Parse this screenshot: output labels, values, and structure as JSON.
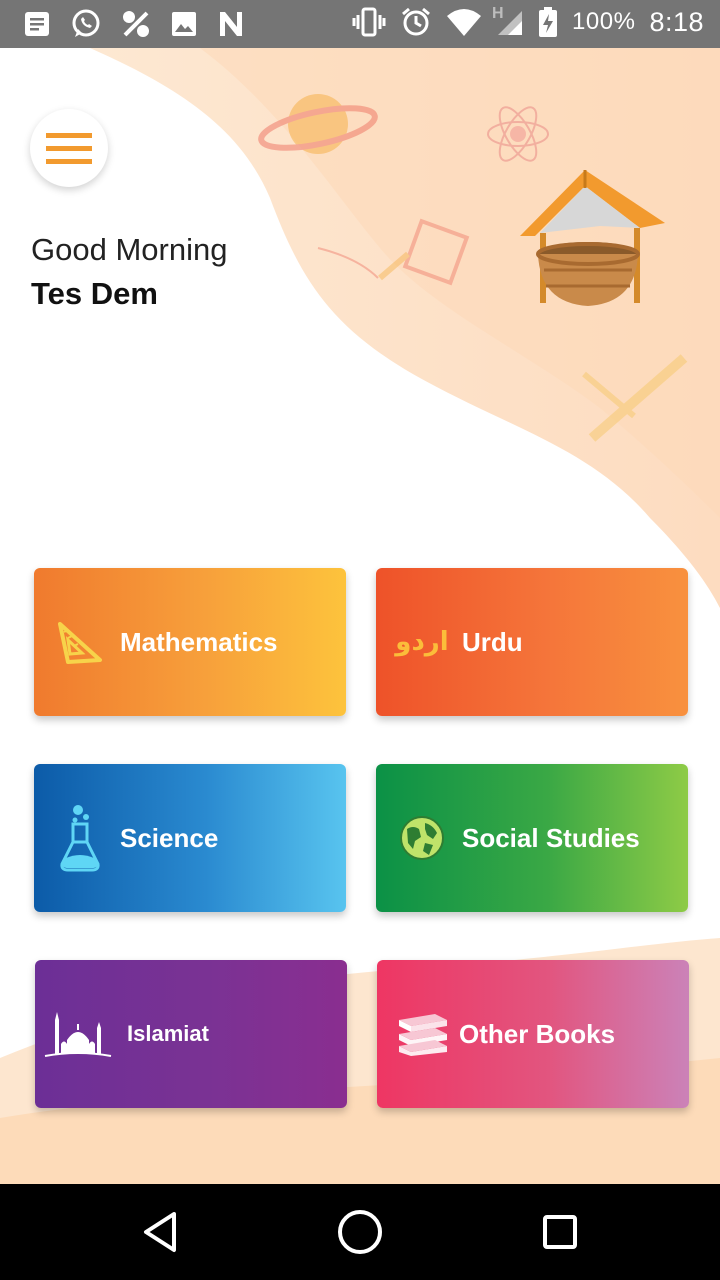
{
  "status_bar": {
    "battery_percent": "100%",
    "time": "8:18",
    "network_type": "H",
    "icons_left": [
      "notes-icon",
      "whatsapp-icon",
      "percent-icon",
      "image-icon",
      "n-icon"
    ],
    "icons_right": [
      "vibrate-icon",
      "alarm-icon",
      "wifi-icon",
      "signal-icon",
      "battery-charging-icon"
    ]
  },
  "header": {
    "greeting": "Good Morning",
    "user_name": "Tes Dem"
  },
  "subjects": [
    {
      "label": "Mathematics",
      "icon": "set-square-icon"
    },
    {
      "label": "Urdu",
      "icon": "urdu-script-icon",
      "icon_text": "اردو"
    },
    {
      "label": "Science",
      "icon": "flask-icon"
    },
    {
      "label": "Social Studies",
      "icon": "globe-icon"
    },
    {
      "label": "Islamiat",
      "icon": "mosque-icon"
    },
    {
      "label": "Other Books",
      "icon": "books-stack-icon"
    }
  ],
  "colors": {
    "accent": "#F29A2E",
    "mathematics": "#F7A03B",
    "urdu": "#F26B36",
    "science": "#2A8AD0",
    "social_studies": "#3AA845",
    "islamiat": "#7A3294",
    "other_books": "#E2557F"
  },
  "nav_bar": {
    "buttons": [
      "back-icon",
      "home-icon",
      "recents-icon"
    ]
  }
}
